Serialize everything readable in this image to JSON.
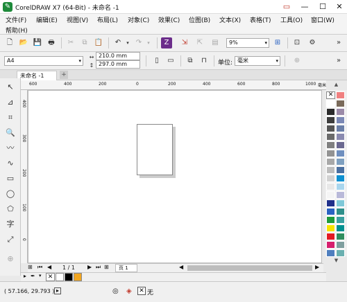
{
  "window": {
    "title": "CorelDRAW X7 (64-Bit) - 未命名 -1",
    "controls": [
      "▭",
      "—",
      "☐",
      "✕"
    ]
  },
  "menu": [
    "文件(F)",
    "编辑(E)",
    "视图(V)",
    "布局(L)",
    "对象(C)",
    "效果(C)",
    "位图(B)",
    "文本(X)",
    "表格(T)",
    "工具(O)",
    "窗口(W)",
    "帮助(H)"
  ],
  "toolbar": {
    "zoom_value": "9%"
  },
  "property_bar": {
    "page_size": "A4",
    "width": "210.0 mm",
    "height": "297.0 mm",
    "unit_label": "单位:",
    "unit_value": "毫米"
  },
  "document_tab": {
    "name": "未命名 -1",
    "add": "+"
  },
  "ruler": {
    "h_ticks": [
      "600",
      "400",
      "200",
      "0",
      "200",
      "400",
      "600",
      "800",
      "1000"
    ],
    "unit": "毫米",
    "v_ticks": [
      "400",
      "300",
      "200",
      "100",
      "0",
      "100"
    ]
  },
  "page_nav": {
    "count": "1 / 1",
    "page_tab": "页 1"
  },
  "status_bar": {
    "coords": "( 57.166, 29.793 )",
    "fill_label": "无"
  },
  "colors": {
    "palette_left": [
      "#ffffff",
      "#2b2b2b",
      "#3d3d3d",
      "#555555",
      "#6b6b6b",
      "#7f7f7f",
      "#939393",
      "#a8a8a8",
      "#bdbdbd",
      "#d2d2d2",
      "#e8e8e8",
      "#f5f5f5",
      "#1f2f8a",
      "#2a62c2",
      "#1e9a3c",
      "#f6e400",
      "#e31b23",
      "#d61f6e",
      "#4f7fbf"
    ],
    "palette_right": [
      "#f08080",
      "#7a6a5a",
      "#9b8aa8",
      "#7b88b5",
      "#6b7fa8",
      "#8a8ab0",
      "#6a6890",
      "#6f8fbf",
      "#7fa0c0",
      "#4a6fa0",
      "#0e90d0",
      "#a9d6ee",
      "#b9b9d9",
      "#7ec8d8",
      "#2e8f8a",
      "#3aa0a0",
      "#009090",
      "#2f8f5f",
      "#7f9f9f",
      "#6ab0b0"
    ]
  }
}
